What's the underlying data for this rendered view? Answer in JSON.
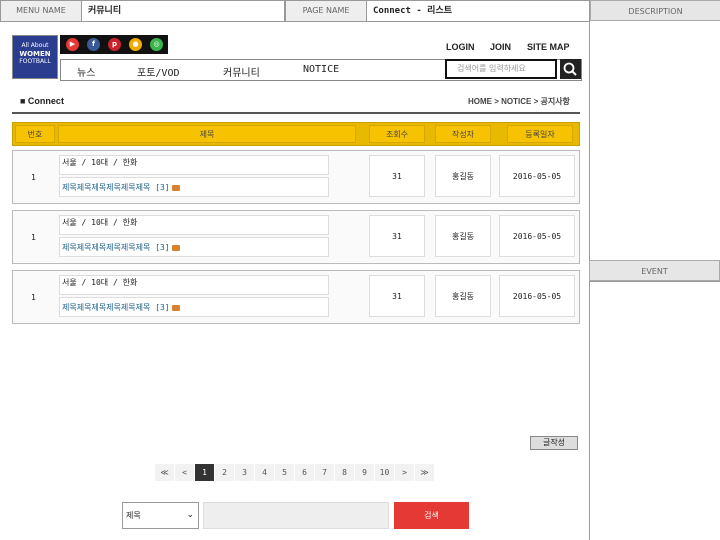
{
  "meta": {
    "menu_label": "MENU NAME",
    "menu_value": "커뮤니티",
    "page_label": "PAGE NAME",
    "page_value": "Connect - 리스트",
    "description_label": "DESCRIPTION",
    "event_label": "EVENT"
  },
  "logo": {
    "line1": "All About",
    "line2": "WOMEN",
    "line3": "FOOTBALL"
  },
  "social": [
    {
      "name": "youtube-icon",
      "glyph": "▶",
      "color": "#e53935"
    },
    {
      "name": "facebook-icon",
      "glyph": "f",
      "color": "#3b5998"
    },
    {
      "name": "pinterest-icon",
      "glyph": "p",
      "color": "#c8232c"
    },
    {
      "name": "kakao-icon",
      "glyph": "●",
      "color": "#f2a900"
    },
    {
      "name": "naver-band-icon",
      "glyph": "◎",
      "color": "#3ab54a"
    }
  ],
  "toplinks": {
    "login": "LOGIN",
    "join": "JOIN",
    "sitemap": "SITE MAP"
  },
  "nav": {
    "news": "뉴스",
    "photo": "포토/VOD",
    "community": "커뮤니티",
    "notice": "NOTICE"
  },
  "search_top": {
    "placeholder": "검색어를 입력하세요"
  },
  "section": {
    "title": "■ Connect",
    "breadcrumb": "HOME > NOTICE > 공지사항"
  },
  "table": {
    "headers": {
      "num": "번호",
      "title": "제목",
      "views": "조회수",
      "author": "작성자",
      "date": "등록일자"
    },
    "rows": [
      {
        "num": "1",
        "loc": "서울 / 10대 / 한화",
        "title": "제목제목제목제목제목제목 [3]",
        "views": "31",
        "author": "홍길동",
        "date": "2016-05-05"
      },
      {
        "num": "1",
        "loc": "서울 / 10대 / 한화",
        "title": "제목제목제목제목제목제목 [3]",
        "views": "31",
        "author": "홍길동",
        "date": "2016-05-05"
      },
      {
        "num": "1",
        "loc": "서울 / 10대 / 한화",
        "title": "제목제목제목제목제목제목 [3]",
        "views": "31",
        "author": "홍길동",
        "date": "2016-05-05"
      }
    ]
  },
  "write_button": "글작성",
  "pager": {
    "first": "≪",
    "prev": "<",
    "next": ">",
    "last": "≫",
    "pages": [
      "1",
      "2",
      "3",
      "4",
      "5",
      "6",
      "7",
      "8",
      "9",
      "10"
    ],
    "current": "1"
  },
  "search_bottom": {
    "select_value": "제목",
    "button": "검색"
  }
}
